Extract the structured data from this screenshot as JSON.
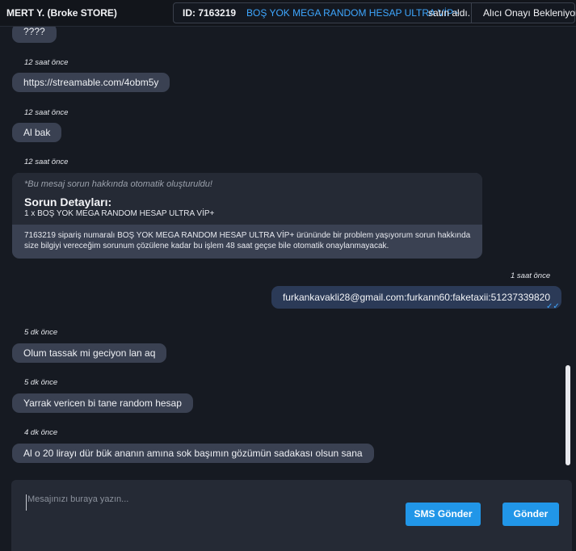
{
  "header": {
    "user": "MERT Y. (Broke STORE)",
    "order_id": "ID: 7163219",
    "product": "BOŞ YOK MEGA RANDOM HESAP ULTRA VİP+",
    "action": "satın aldı.",
    "status": "Alıcı Onayı Bekleniyor"
  },
  "messages": [
    {
      "text": "????",
      "time": ""
    },
    {
      "time": "12 saat önce",
      "text": "https://streamable.com/4obm5y"
    },
    {
      "time": "12 saat önce",
      "text": "Al bak"
    },
    {
      "time": "12 saat önce"
    },
    {
      "time": "5 dk önce",
      "text": "Olum tassak mi geciyon lan aq"
    },
    {
      "time": "5 dk önce",
      "text": "Yarrak vericen bi tane random hesap"
    },
    {
      "time": "4 dk önce",
      "text": "Al o 20 lirayı dür bük ananın amına sok başımın gözümün sadakası olsun sana"
    }
  ],
  "auto_message": {
    "note": "*Bu mesaj sorun hakkında otomatik oluşturuldu!",
    "title": "Sorun Detayları:",
    "item": "1 x BOŞ YOK MEGA RANDOM HESAP ULTRA VİP+",
    "description": "7163219 sipariş numaralı BOŞ YOK MEGA RANDOM HESAP ULTRA VİP+ ürününde bir problem yaşıyorum sorun hakkında size bilgiyi vereceğim sorunum çözülene kadar bu işlem 48 saat geçse bile otomatik onaylanmayacak."
  },
  "sent_message": {
    "time": "1 saat önce",
    "text": "furkankavakli28@gmail.com:furkann60:faketaxii:51237339820",
    "check": "✓✓"
  },
  "composer": {
    "placeholder": "Mesajınızı buraya yazın...",
    "sms_button": "SMS Gönder",
    "send_button": "Gönder"
  },
  "colors": {
    "accent": "#2196e8",
    "bubble_received": "#3a4152",
    "bubble_sent": "#2b3a57",
    "background": "#161a22"
  }
}
